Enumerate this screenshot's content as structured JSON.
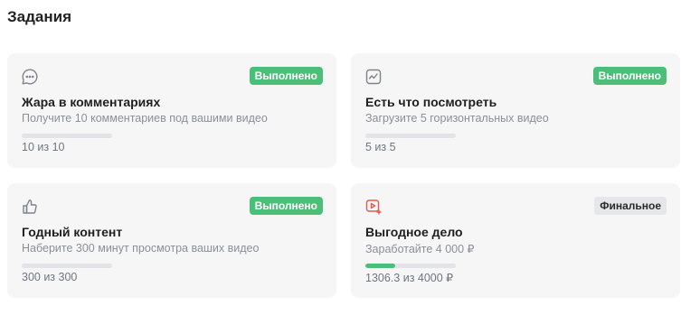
{
  "page": {
    "title": "Задания"
  },
  "colors": {
    "done_badge": "#4bbf7a",
    "final_badge": "#e6e7ea",
    "icon_accent": "#e05a4f"
  },
  "tasks": [
    {
      "icon": "chat-bubble-icon",
      "title": "Жара в комментариях",
      "description": "Получите 10 комментариев под вашими видео",
      "badge": "Выполнено",
      "status": "done",
      "progress_fraction": 0,
      "progress_text": "10 из 10"
    },
    {
      "icon": "activity-chart-icon",
      "title": "Есть что посмотреть",
      "description": "Загрузите 5 горизонтальных видео",
      "badge": "Выполнено",
      "status": "done",
      "progress_fraction": 0,
      "progress_text": "5 из 5"
    },
    {
      "icon": "thumbs-up-icon",
      "title": "Годный контент",
      "description": "Наберите 300 минут просмотра ваших видео",
      "badge": "Выполнено",
      "status": "done",
      "progress_fraction": 0,
      "progress_text": "300 из 300"
    },
    {
      "icon": "video-play-icon",
      "title": "Выгодное дело",
      "description": "Заработайте 4 000 ₽",
      "badge": "Финальное",
      "status": "final",
      "progress_fraction": 0.33,
      "progress_text": "1306.3 из 4000 ₽"
    }
  ]
}
